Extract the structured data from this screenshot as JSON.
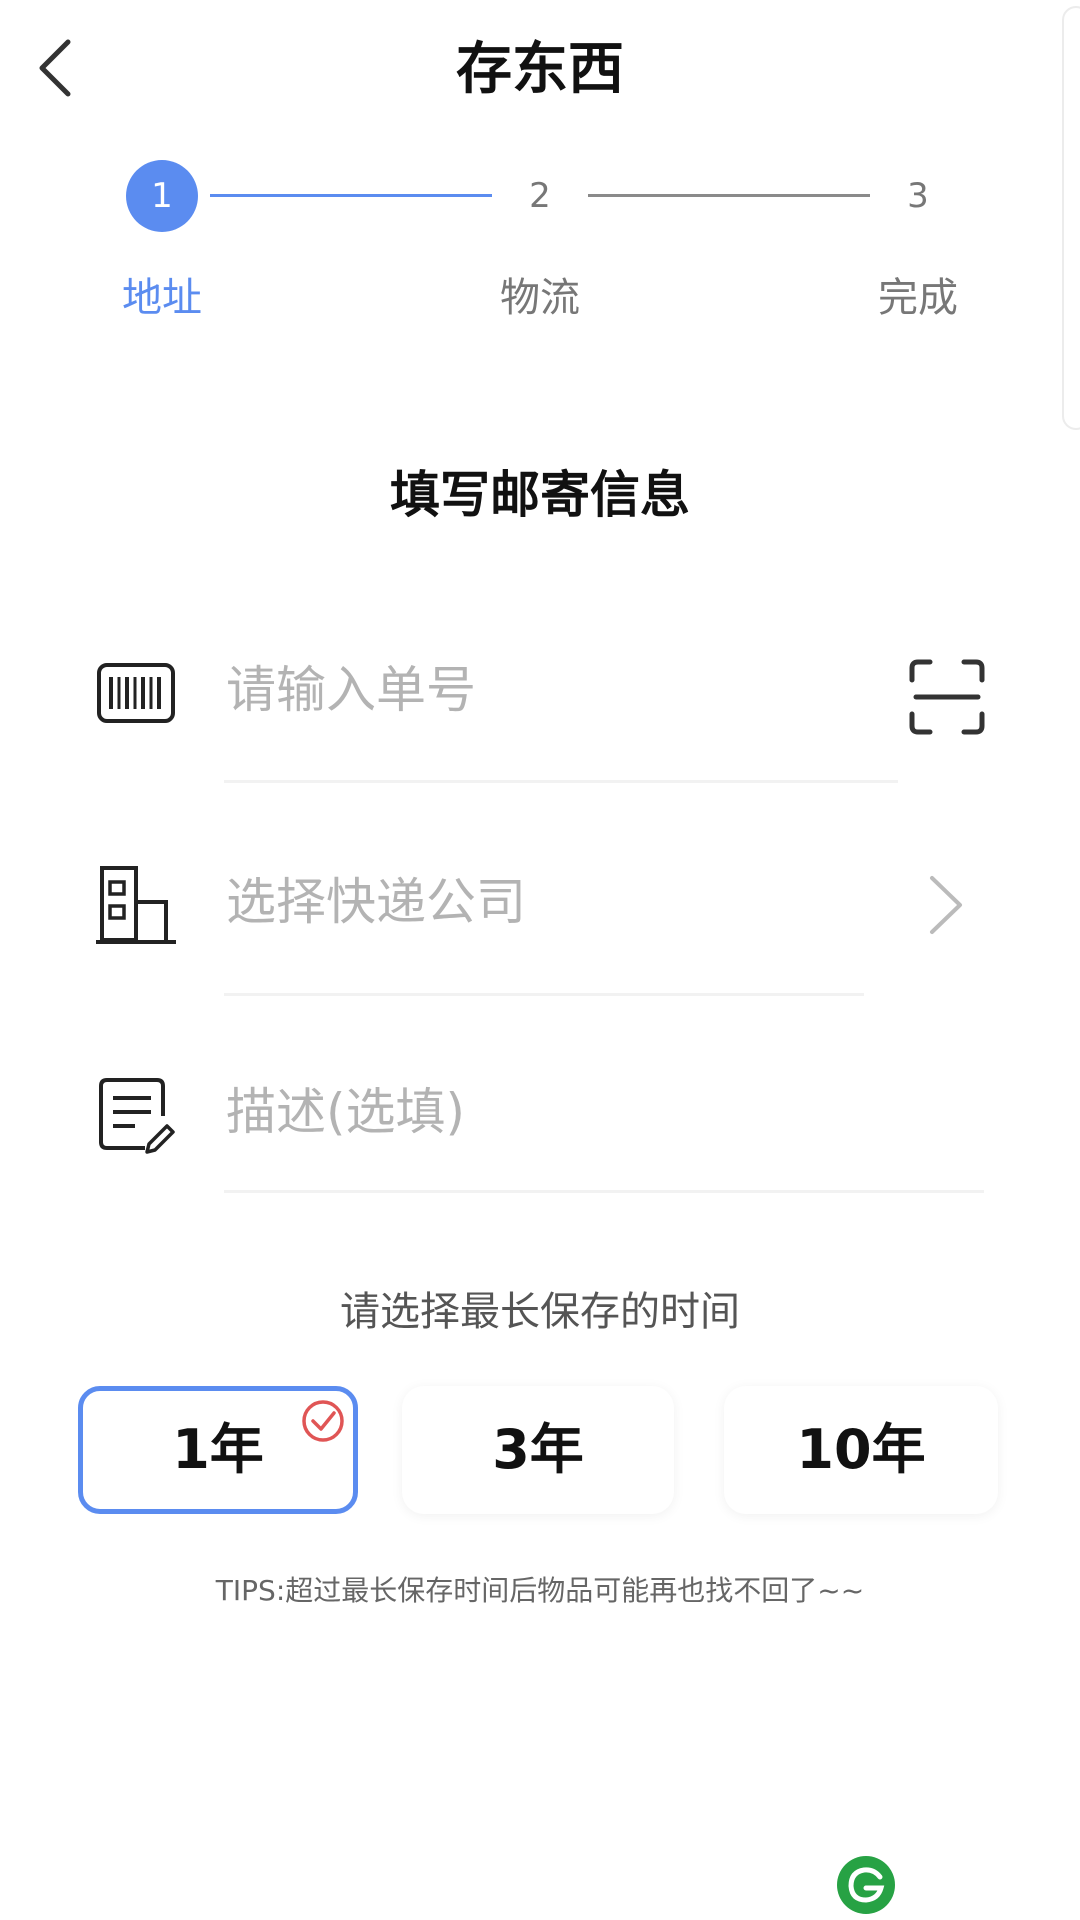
{
  "header": {
    "title": "存东西"
  },
  "stepper": {
    "steps": [
      {
        "number": "1",
        "label": "地址"
      },
      {
        "number": "2",
        "label": "物流"
      },
      {
        "number": "3",
        "label": "完成"
      }
    ],
    "active_step": 1
  },
  "form": {
    "title": "填写邮寄信息",
    "tracking_number": {
      "placeholder": "请输入单号",
      "icon": "barcode-icon",
      "action_icon": "scan-icon"
    },
    "courier": {
      "placeholder": "选择快递公司",
      "icon": "building-icon",
      "action_icon": "chevron-right-icon"
    },
    "description": {
      "placeholder": "描述(选填)",
      "icon": "edit-document-icon"
    }
  },
  "retention": {
    "label": "请选择最长保存的时间",
    "options": [
      {
        "label": "1年",
        "selected": true
      },
      {
        "label": "3年",
        "selected": false
      },
      {
        "label": "10年",
        "selected": false
      }
    ]
  },
  "tips": "TIPS:超过最长保存时间后物品可能再也找不回了~~",
  "colors": {
    "accent": "#5b8cf0",
    "check": "#e05555",
    "placeholder": "#b3b3b3"
  }
}
